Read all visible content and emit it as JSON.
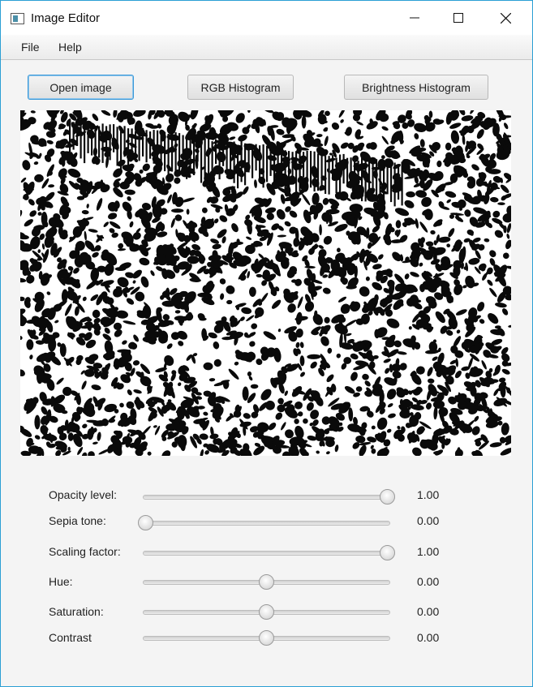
{
  "window": {
    "title": "Image Editor"
  },
  "icons": {
    "app": "app-window-icon",
    "minimize": "minimize-icon",
    "maximize": "maximize-icon",
    "close": "close-icon"
  },
  "menu": {
    "file": "File",
    "help": "Help"
  },
  "toolbar": {
    "open_label": "Open image",
    "rgb_label": "RGB Histogram",
    "brightness_label": "Brightness Histogram"
  },
  "controls": [
    {
      "label": "Opacity level:",
      "value": "1.00",
      "fraction": 1.0
    },
    {
      "label": "Sepia tone:",
      "value": "0.00",
      "fraction": 0.0
    },
    {
      "label": "Scaling factor:",
      "value": "1.00",
      "fraction": 1.0
    },
    {
      "label": "Hue:",
      "value": "0.00",
      "fraction": 0.5
    },
    {
      "label": "Saturation:",
      "value": "0.00",
      "fraction": 0.5
    },
    {
      "label": "Contrast",
      "value": "0.00",
      "fraction": 0.5
    }
  ],
  "colors": {
    "window_border": "#2b9fd4",
    "focus_accent": "#3b99d8"
  }
}
